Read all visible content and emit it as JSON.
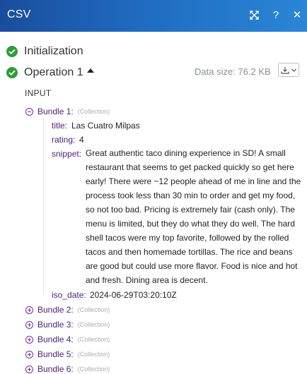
{
  "window": {
    "title": "CSV"
  },
  "steps": [
    {
      "label": "Initialization"
    },
    {
      "label": "Operation 1"
    }
  ],
  "operation": {
    "data_size": "Data size: 76.2 KB"
  },
  "input_header": "INPUT",
  "bundles": [
    {
      "name": "Bundle 1:",
      "type": "(Collection)",
      "expanded": true,
      "fields": {
        "title": {
          "key": "title:",
          "value": "Las Cuatro Milpas"
        },
        "rating": {
          "key": "rating:",
          "value": "4"
        },
        "snippet": {
          "key": "snippet:",
          "value": "Great authentic taco dining experience in SD! A small restaurant that seems to get packed quickly so get here early! There were ~12 people ahead of me in line and the process took less than 30 min to order and get my food, so not too bad. Pricing is extremely fair (cash only). The menu is limited, but they do what they do well. The hard shell tacos were my top favorite, followed by the rolled tacos and then homemade tortillas. The rice and beans are good but could use more flavor. Food is nice and hot and fresh. Dining area is decent."
        },
        "iso_date": {
          "key": "iso_date:",
          "value": "2024-06-29T03:20:10Z"
        }
      }
    },
    {
      "name": "Bundle 2:",
      "type": "(Collection)",
      "expanded": false
    },
    {
      "name": "Bundle 3:",
      "type": "(Collection)",
      "expanded": false
    },
    {
      "name": "Bundle 4:",
      "type": "(Collection)",
      "expanded": false
    },
    {
      "name": "Bundle 5:",
      "type": "(Collection)",
      "expanded": false
    },
    {
      "name": "Bundle 6:",
      "type": "(Collection)",
      "expanded": false
    }
  ],
  "colors": {
    "header": "#1f6bc0",
    "success": "#2e9d3b",
    "key": "#4b1f78",
    "accent": "#7a2aa8"
  },
  "icons": [
    "expand-icon",
    "help-icon",
    "close-icon",
    "check-icon",
    "caret-up-icon",
    "download-icon",
    "chevron-down-icon",
    "collapse-icon",
    "expand-bundle-icon"
  ]
}
